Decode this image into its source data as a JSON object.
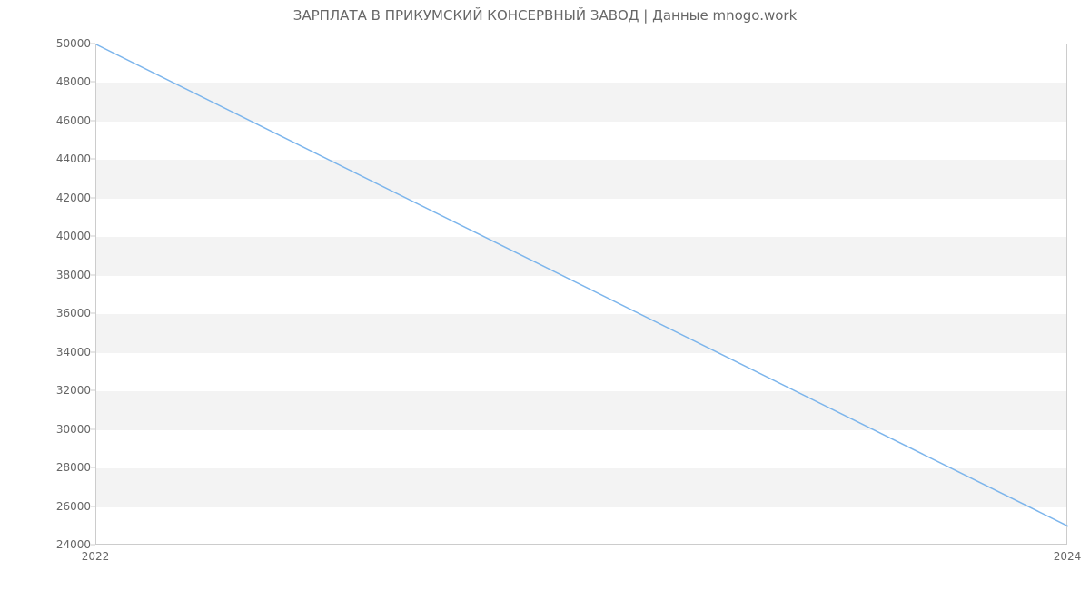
{
  "chart_data": {
    "type": "line",
    "title": "ЗАРПЛАТА В  ПРИКУМСКИЙ КОНСЕРВНЫЙ ЗАВОД | Данные mnogo.work",
    "xlabel": "",
    "ylabel": "",
    "x": [
      "2022",
      "2024"
    ],
    "values": [
      50000,
      25000
    ],
    "x_ticks": [
      "2022",
      "2024"
    ],
    "y_ticks": [
      24000,
      26000,
      28000,
      30000,
      32000,
      34000,
      36000,
      38000,
      40000,
      42000,
      44000,
      46000,
      48000,
      50000
    ],
    "ylim": [
      24000,
      50000
    ],
    "line_color": "#7cb5ec",
    "grid_bands": true
  }
}
